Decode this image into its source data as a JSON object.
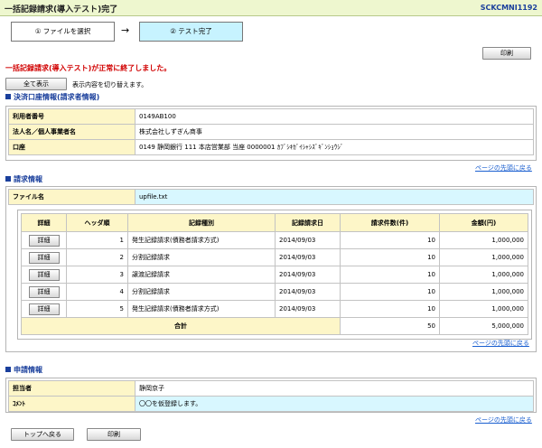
{
  "header": {
    "title": "一括記録請求(導入テスト)完了",
    "screen_id": "SCKCMNI1192"
  },
  "steps": [
    {
      "label": "① ファイルを選択"
    },
    {
      "label": "② テスト完了"
    }
  ],
  "step_arrow": "→",
  "buttons": {
    "print": "印刷",
    "show_all": "全て表示",
    "detail": "詳細",
    "back_top": "トップへ戻る"
  },
  "message": {
    "success": "一括記録請求(導入テスト)が正常に終了しました。"
  },
  "show_all_note": "表示内容を切り替えます。",
  "page_top_link": "ページの先頭に戻る",
  "settlement": {
    "heading": "決済口座情報(請求者情報)",
    "rows": [
      {
        "label": "利用者番号",
        "value": "0149AB100"
      },
      {
        "label": "法人名／個人事業者名",
        "value": "株式会社しずぎん商事"
      },
      {
        "label": "口座",
        "value": "0149 静岡銀行 111 本店営業部 当座 0000001 ｶﾌﾞｼｷｶﾞｲｼｬｼｽﾞｷﾞﾝｼｮｳｼﾞ"
      }
    ]
  },
  "request": {
    "heading": "請求情報",
    "file_label": "ファイル名",
    "file_name": "upfile.txt",
    "columns": [
      "詳細",
      "ヘッダ順",
      "記録種別",
      "記録請求日",
      "請求件数(件)",
      "金額(円)"
    ],
    "rows": [
      {
        "order": "1",
        "type": "発生記録請求(債務者請求方式)",
        "date": "2014/09/03",
        "count": "10",
        "amount": "1,000,000"
      },
      {
        "order": "2",
        "type": "分割記録請求",
        "date": "2014/09/03",
        "count": "10",
        "amount": "1,000,000"
      },
      {
        "order": "3",
        "type": "譲渡記録請求",
        "date": "2014/09/03",
        "count": "10",
        "amount": "1,000,000"
      },
      {
        "order": "4",
        "type": "分割記録請求",
        "date": "2014/09/03",
        "count": "10",
        "amount": "1,000,000"
      },
      {
        "order": "5",
        "type": "発生記録請求(債務者請求方式)",
        "date": "2014/09/03",
        "count": "10",
        "amount": "1,000,000"
      }
    ],
    "total_label": "合計",
    "total_count": "50",
    "total_amount": "5,000,000"
  },
  "application": {
    "heading": "申請情報",
    "rows": [
      {
        "label": "担当者",
        "value": "静岡京子"
      },
      {
        "label": "ｺﾒﾝﾄ",
        "value": "〇〇を仮登録します。"
      }
    ]
  }
}
